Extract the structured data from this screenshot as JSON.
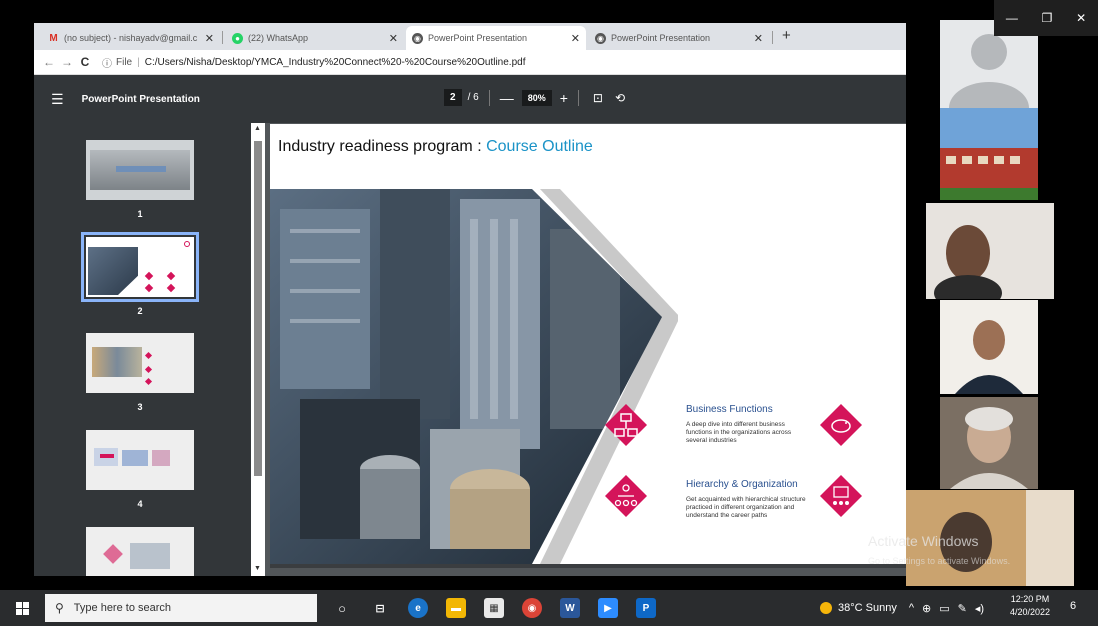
{
  "browser": {
    "tabs": [
      {
        "label": "(no subject) - nishayadv@gmail.c",
        "icon": "gmail-icon"
      },
      {
        "label": "(22) WhatsApp",
        "icon": "whatsapp-icon"
      },
      {
        "label": "PowerPoint Presentation",
        "icon": "globe-icon"
      },
      {
        "label": "PowerPoint Presentation",
        "icon": "globe-icon"
      }
    ],
    "address": {
      "scheme_label": "File",
      "path": "C:/Users/Nisha/Desktop/YMCA_Industry%20Connect%20-%20Course%20Outline.pdf"
    }
  },
  "pdf": {
    "title": "PowerPoint Presentation",
    "current_page": "2",
    "total_pages": "/ 6",
    "zoom": "80%",
    "thumbnails": [
      "1",
      "2",
      "3",
      "4"
    ],
    "selected_page": 2
  },
  "slide": {
    "title_main": "Industry readiness program : ",
    "title_accent": "Course Outline",
    "items": [
      {
        "heading": "Business Functions",
        "desc": "A deep dive into different business functions in the organizations across several industries"
      },
      {
        "heading": "Hierarchy & Organization",
        "desc": "Get acquainted with hierarchical structure practiced in different organization and understand the career paths"
      }
    ]
  },
  "watermark": {
    "title": "Activate Windows",
    "sub": "Go to Settings to activate Windows."
  },
  "taskbar": {
    "search_placeholder": "Type here to search",
    "weather": "38°C  Sunny",
    "time": "12:20 PM",
    "date": "4/20/2022",
    "notifications": "6"
  },
  "colors": {
    "accent": "#1b93c7",
    "pink": "#d4145a",
    "pdf_toolbar": "#323639"
  }
}
